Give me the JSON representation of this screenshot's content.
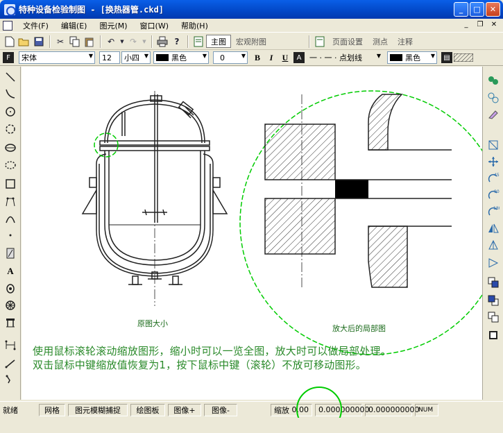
{
  "window": {
    "title": "特种设备检验制图 - [换热器管.ckd]"
  },
  "menu": {
    "items": [
      "文件(F)",
      "编辑(E)",
      "图元(M)",
      "窗口(W)",
      "帮助(H)"
    ]
  },
  "toolbar1": {
    "tabs": [
      "主图",
      "宏观附图",
      "页面设置",
      "测点",
      "注释"
    ]
  },
  "toolbar2": {
    "font_name": "宋体",
    "font_size": "12",
    "font_size_name": "小四",
    "text_color": "黑色",
    "line_width": "0",
    "bold": "B",
    "italic": "I",
    "underline": "U",
    "line_style": "一 · 一 · 点划线",
    "fill_color": "黑色"
  },
  "canvas": {
    "caption_original": "原图大小",
    "caption_zoomed": "放大后的局部图",
    "hint_line1": "使用鼠标滚轮滚动缩放图形，缩小时可以一览全图，放大时可以做局部处理。",
    "hint_line2": "双击鼠标中键缩放值恢复为1，按下鼠标中键（滚轮）不放可移动图形。"
  },
  "statusbar": {
    "status": "就绪",
    "grid": "网格",
    "snap": "图元模糊捕捉",
    "drawboard": "绘图板",
    "image_plus": "图像+",
    "image_minus": "图像-",
    "zoom_label": "缩放",
    "zoom_value": "0.00",
    "x_value": "0.000000000",
    "y_value": "0.000000000",
    "num": "NUM"
  },
  "colors": {
    "title_bg": "#0247c6",
    "hint": "#2a8a2a",
    "caption": "#1a6a1a",
    "highlight": "#00cc00"
  }
}
